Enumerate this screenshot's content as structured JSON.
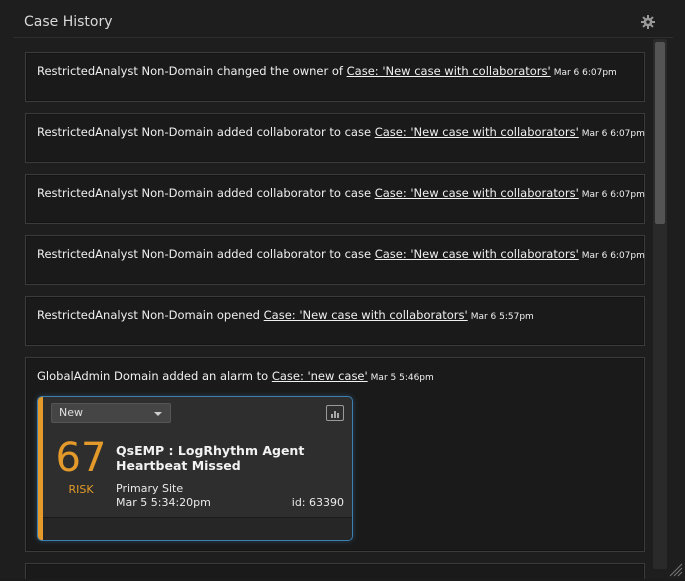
{
  "widget": {
    "title": "Case History",
    "settings_icon": "gear-icon"
  },
  "entries": [
    {
      "text": "RestrictedAnalyst Non-Domain changed the owner of ",
      "link": "Case: 'New case with collaborators'",
      "time": "Mar 6 6:07pm"
    },
    {
      "text": "RestrictedAnalyst Non-Domain added collaborator to case ",
      "link": "Case: 'New case with collaborators'",
      "time": "Mar 6 6:07pm"
    },
    {
      "text": "RestrictedAnalyst Non-Domain added collaborator to case ",
      "link": "Case: 'New case with collaborators'",
      "time": "Mar 6 6:07pm"
    },
    {
      "text": "RestrictedAnalyst Non-Domain added collaborator to case ",
      "link": "Case: 'New case with collaborators'",
      "time": "Mar 6 6:07pm"
    },
    {
      "text": "RestrictedAnalyst Non-Domain opened ",
      "link": "Case: 'New case with collaborators'",
      "time": "Mar 6 5:57pm"
    },
    {
      "text": "GlobalAdmin Domain added an alarm to ",
      "link": "Case: 'new case'",
      "time": "Mar 5 5:46pm"
    }
  ],
  "alarm": {
    "status": "New",
    "score": "67",
    "score_label": "RISK",
    "name": "QsEMP : LogRhythm Agent Heartbeat Missed",
    "site": "Primary Site",
    "date": "Mar 5 5:34:20pm",
    "id": "id: 63390",
    "accent_color": "#e39a2a",
    "border_color": "#3c7fb0"
  }
}
